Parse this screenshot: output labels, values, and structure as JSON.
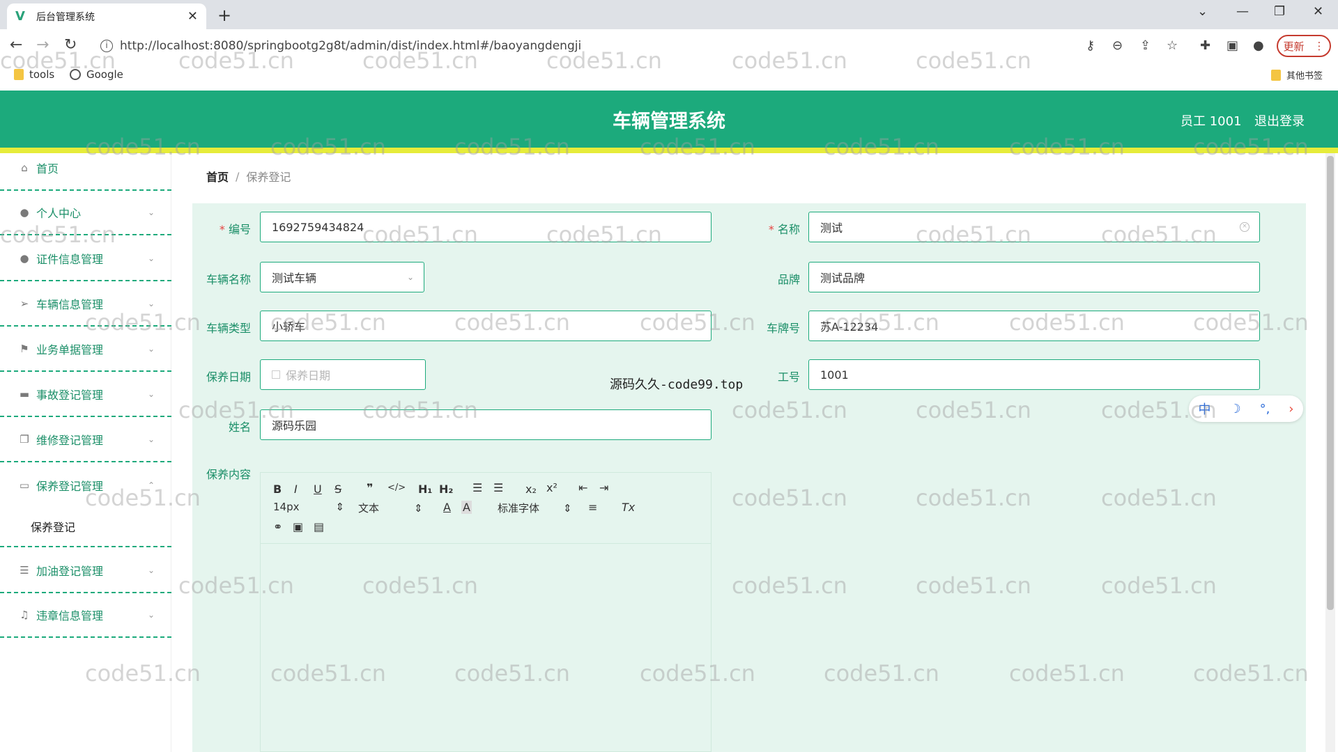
{
  "browser": {
    "tab_title": "后台管理系统",
    "url": "http://localhost:8080/springbootg2g8t/admin/dist/index.html#/baoyangdengji",
    "update_label": "更新",
    "bookmarks": [
      "tools",
      "Google"
    ],
    "other_bookmarks": "其他书签"
  },
  "header": {
    "title": "车辆管理系统",
    "user": "员工 1001",
    "logout": "退出登录"
  },
  "sidebar": {
    "items": [
      {
        "label": "首页",
        "icon": "home-icon"
      },
      {
        "label": "个人中心",
        "icon": "user-icon"
      },
      {
        "label": "证件信息管理",
        "icon": "user-icon"
      },
      {
        "label": "车辆信息管理",
        "icon": "send-icon"
      },
      {
        "label": "业务单据管理",
        "icon": "flag-icon"
      },
      {
        "label": "事故登记管理",
        "icon": "car-icon"
      },
      {
        "label": "维修登记管理",
        "icon": "copy-icon"
      },
      {
        "label": "保养登记管理",
        "icon": "message-icon"
      },
      {
        "label": "加油登记管理",
        "icon": "list-icon"
      },
      {
        "label": "违章信息管理",
        "icon": "bell-icon"
      }
    ],
    "sub_item": "保养登记"
  },
  "breadcrumb": {
    "home": "首页",
    "separator": "/",
    "current": "保养登记"
  },
  "form": {
    "number": {
      "label": "编号",
      "value": "1692759434824"
    },
    "name": {
      "label": "名称",
      "value": "测试"
    },
    "vehicle_name": {
      "label": "车辆名称",
      "value": "测试车辆"
    },
    "brand": {
      "label": "品牌",
      "value": "测试品牌"
    },
    "vehicle_type": {
      "label": "车辆类型",
      "value": "小轿车"
    },
    "plate": {
      "label": "车牌号",
      "value": "苏A-12234"
    },
    "date": {
      "label": "保养日期",
      "placeholder": "保养日期"
    },
    "job_no": {
      "label": "工号",
      "value": "1001"
    },
    "person_name": {
      "label": "姓名",
      "value": "源码乐园"
    },
    "content": {
      "label": "保养内容"
    }
  },
  "editor": {
    "font_size": "14px",
    "text_type": "文本",
    "font_family": "标准字体"
  },
  "float_text": "源码久久-code99.top",
  "ime": {
    "lang": "中"
  },
  "watermark": "code51.cn"
}
